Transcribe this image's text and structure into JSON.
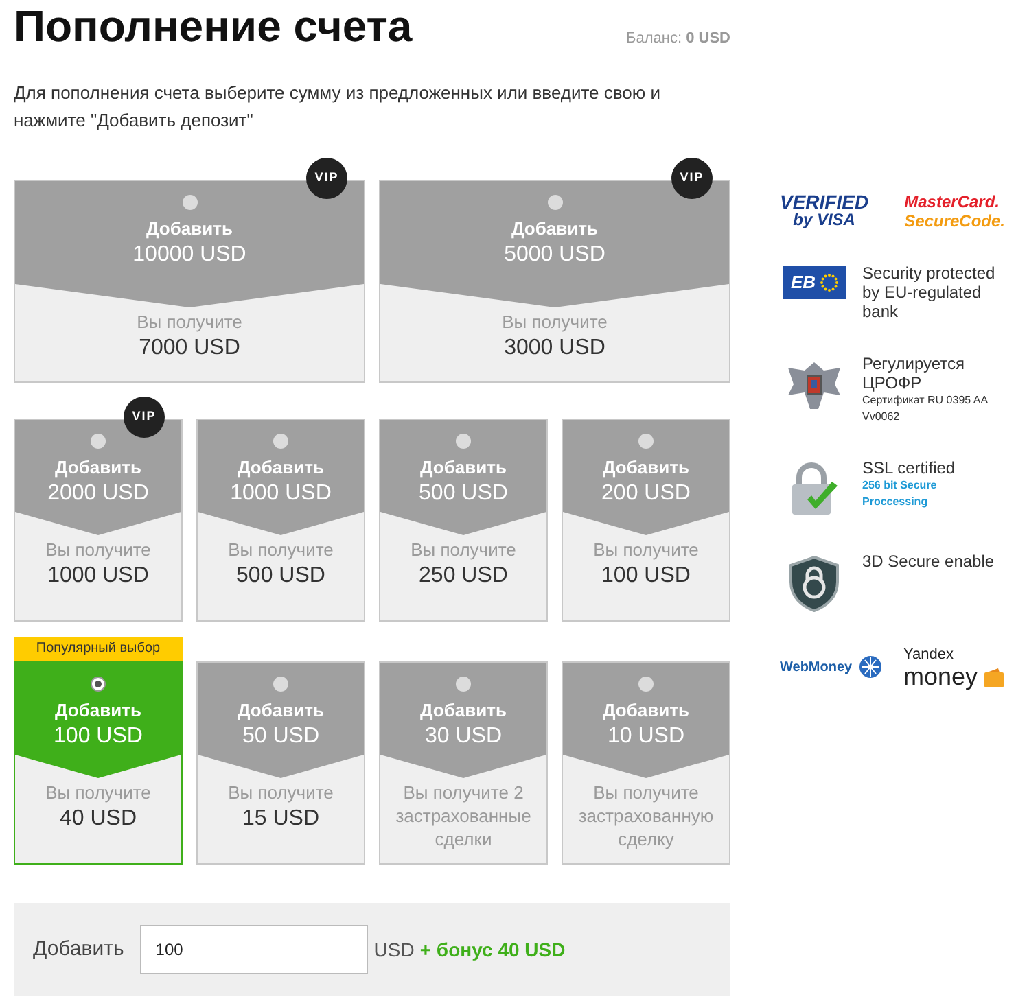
{
  "header": {
    "title": "Пополнение счета",
    "balance": "Баланс: **0 USD**"
  },
  "description": "Для пополнения счета выберите сумму из предложенных или введите свою и нажмите \"Добавить депозит\"",
  "rows": [
    {
      "cards": [
        {
          "add_label": "Добавить",
          "amount": "10000 USD",
          "receive_label": "Вы получите",
          "receive_value": "7000 USD",
          "vip": "VIP",
          "selected": false
        },
        {
          "add_label": "Добавить",
          "amount": "5000 USD",
          "receive_label": "Вы получите",
          "receive_value": "3000 USD",
          "vip": "VIP",
          "selected": false
        }
      ]
    },
    {
      "cards": [
        {
          "add_label": "Добавить",
          "amount": "2000 USD",
          "receive_label": "Вы получите",
          "receive_value": "1000 USD",
          "vip": "VIP",
          "selected": false
        },
        {
          "add_label": "Добавить",
          "amount": "1000 USD",
          "receive_label": "Вы получите",
          "receive_value": "500 USD",
          "selected": false
        },
        {
          "add_label": "Добавить",
          "amount": "500 USD",
          "receive_label": "Вы получите",
          "receive_value": "250 USD",
          "selected": false
        },
        {
          "add_label": "Добавить",
          "amount": "200 USD",
          "receive_label": "Вы получите",
          "receive_value": "100 USD",
          "selected": false
        }
      ]
    },
    {
      "cards": [
        {
          "badge": "Популярный выбор",
          "add_label": "Добавить",
          "amount": "100 USD",
          "receive_label": "Вы получите",
          "receive_value": "40 USD",
          "selected": true
        },
        {
          "add_label": "Добавить",
          "amount": "50 USD",
          "receive_label": "Вы получите",
          "receive_value": "15 USD",
          "selected": false
        },
        {
          "add_label": "Добавить",
          "amount": "30 USD",
          "receive_label": "Вы получите 2 застрахованные сделки",
          "selected": false
        },
        {
          "add_label": "Добавить",
          "amount": "10 USD",
          "receive_label": "Вы получите застрахованную сделку",
          "selected": false
        }
      ]
    }
  ],
  "custom_amount": {
    "label": "Добавить",
    "value": "100",
    "currency": "USD",
    "bonus": "+ бонус 40 USD"
  },
  "trust": [
    {
      "kind": "logos",
      "logos": [
        {
          "kind": "visa",
          "line1": "VERIFIED",
          "line2": "by VISA"
        },
        {
          "kind": "mastercard",
          "line1": "MasterCard.",
          "line2": "SecureCode."
        }
      ]
    },
    {
      "kind": "eu",
      "icon_text": "EB",
      "title": "Security protected by EU-regulated bank"
    },
    {
      "kind": "eagle",
      "title": "Регулируется ЦРОФР",
      "note": "Сертификат RU 0395 AA Vv0062"
    },
    {
      "kind": "lock",
      "title": "SSL certified",
      "link": "256 bit Secure Proccessing"
    },
    {
      "kind": "shield",
      "title": "3D Secure enable"
    },
    {
      "kind": "logos",
      "logos": [
        {
          "kind": "webmoney",
          "line1": "WebMoney"
        },
        {
          "kind": "yandex",
          "line1": "Yandex",
          "line2": "money"
        }
      ]
    }
  ]
}
